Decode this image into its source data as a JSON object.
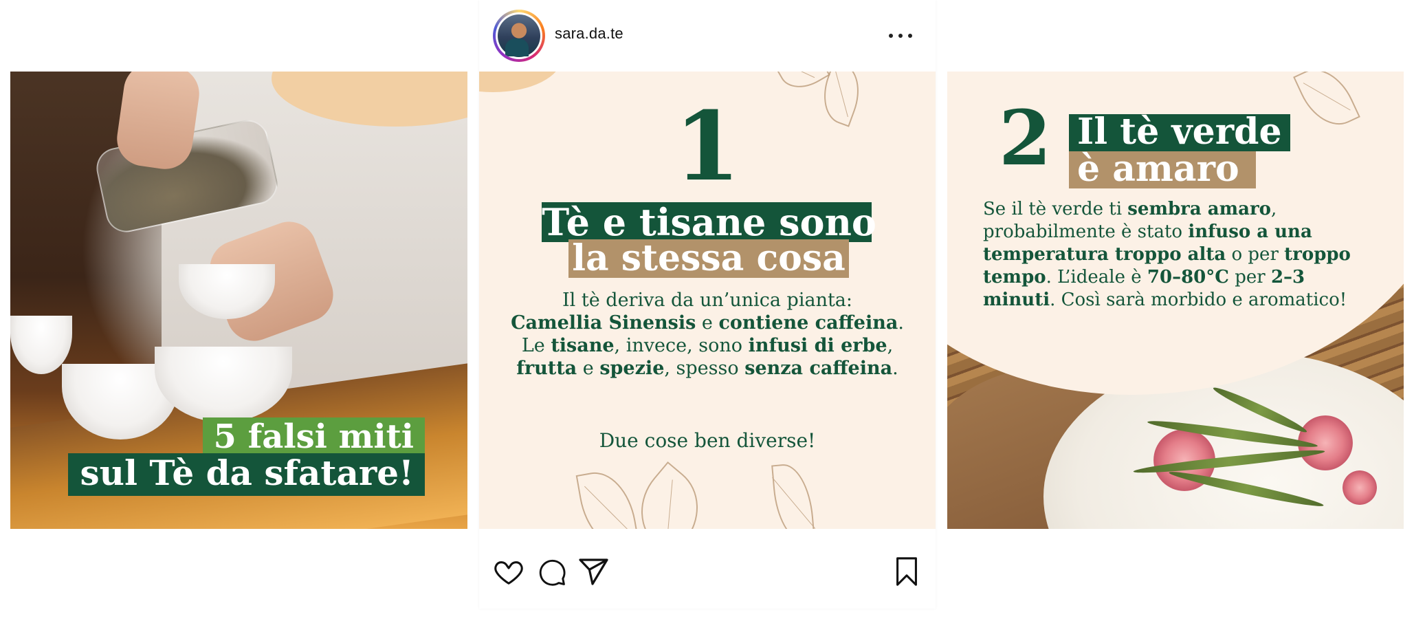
{
  "header": {
    "username": "sara.da.te"
  },
  "icons": {
    "avatar": "avatar",
    "more": "more-horizontal-icon",
    "like": "heart-icon",
    "comment": "comment-icon",
    "share": "send-icon",
    "save": "bookmark-icon"
  },
  "colors": {
    "dark_green": "#14553a",
    "light_green": "#5c9e3f",
    "tan": "#b2926a",
    "cream": "#fcf1e6",
    "peach": "#f2cfa3"
  },
  "slides": [
    {
      "title_line1": "5 falsi miti",
      "title_line2": "sul Tè da sfatare!"
    },
    {
      "number": "1",
      "title_line1": "Tè e tisane sono",
      "title_line2": "la stessa cosa",
      "body": {
        "t1": "Il tè deriva da un’unica pianta:",
        "b1": "Camellia Sinensis",
        "t2": " e ",
        "b2": "contiene caffeina",
        "t3": ". Le ",
        "b3": "tisane",
        "t4": ", invece, sono ",
        "b4": "infusi di erbe",
        "t5": ", ",
        "b5": "frutta",
        "t6": " e ",
        "b6": "spezie",
        "t7": ", spesso ",
        "b7": "senza caffeina",
        "t8": "."
      },
      "footer": "Due cose ben diverse!"
    },
    {
      "number": "2",
      "title_line1": "Il tè verde",
      "title_line2": "è amaro",
      "body": {
        "t1": "Se il tè verde ti ",
        "b1": "sembra amaro",
        "t2": ", probabilmente è stato ",
        "b2": "infuso a una temperatura troppo alta",
        "t3": " o per ",
        "b3": "troppo tempo",
        "t4": ". L’ideale è ",
        "b4": "70–80°C",
        "t5": " per ",
        "b5": "2–3 minuti",
        "t6": ". Così sarà morbido e aromatico!"
      }
    }
  ]
}
